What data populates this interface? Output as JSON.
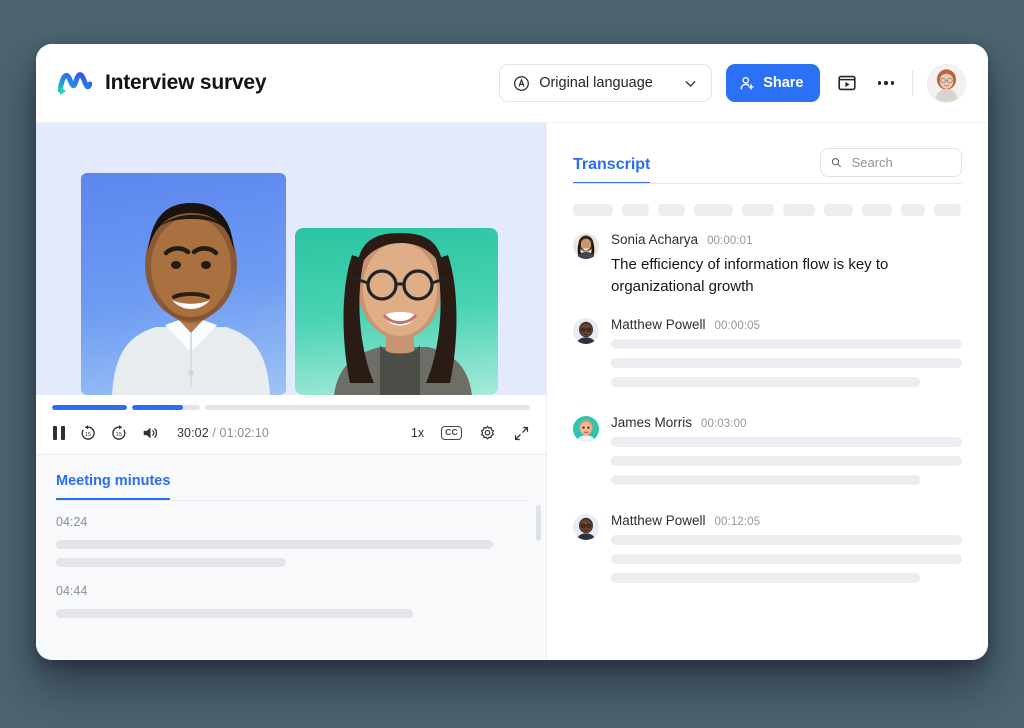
{
  "header": {
    "logo_icon": "wavy-logo-icon",
    "title": "Interview survey",
    "language": {
      "icon": "language-globe-icon",
      "value": "Original language",
      "chevron_icon": "chevron-down-icon"
    },
    "share": {
      "icon": "person-add-icon",
      "label": "Share"
    },
    "present_icon": "present-screen-icon",
    "more_icon": "more-horizontal-icon",
    "avatar": "user-avatar"
  },
  "video": {
    "background_color": "#e3eafc",
    "tiles": [
      {
        "name": "participant-tile-left",
        "accent": "#5b86f0"
      },
      {
        "name": "participant-tile-right",
        "accent": "#2bc4a0"
      }
    ]
  },
  "player": {
    "segments": [
      {
        "fill_percent": 100
      },
      {
        "fill_percent": 75
      },
      {
        "fill_percent": 0
      }
    ],
    "pause_icon": "pause-icon",
    "rewind_icon": "rewind-15-icon",
    "forward_icon": "forward-15-icon",
    "volume_icon": "volume-icon",
    "current_time": "30:02",
    "separator": "/",
    "total_time": "01:02:10",
    "speed_label": "1x",
    "captions_label": "CC",
    "settings_icon": "gear-icon",
    "fullscreen_icon": "expand-icon",
    "accent_color": "#2b6cf5"
  },
  "minutes": {
    "tab_label": "Meeting minutes",
    "entries": [
      {
        "time": "04:24",
        "lines": [
          93,
          49
        ]
      },
      {
        "time": "04:44",
        "lines": [
          76
        ]
      }
    ]
  },
  "transcript": {
    "tab_label": "Transcript",
    "search": {
      "icon": "search-icon",
      "placeholder": "Search",
      "value": ""
    },
    "chips": [
      40,
      27,
      27,
      39,
      32,
      32,
      29,
      30,
      24,
      27
    ],
    "entries": [
      {
        "name": "Sonia Acharya",
        "time": "00:00:01",
        "avatar": "sonia-avatar",
        "text": "The efficiency of information flow is key to organizational growth",
        "lines": []
      },
      {
        "name": "Matthew Powell",
        "time": "00:00:05",
        "avatar": "matthew-avatar",
        "text": "",
        "lines": [
          100,
          100,
          88
        ]
      },
      {
        "name": "James Morris",
        "time": "00:03:00",
        "avatar": "james-avatar",
        "text": "",
        "lines": [
          100,
          100,
          88
        ]
      },
      {
        "name": "Matthew Powell",
        "time": "00:12:05",
        "avatar": "matthew-avatar-2",
        "text": "",
        "lines": [
          100,
          100,
          88
        ]
      }
    ]
  },
  "colors": {
    "page_background": "#4c6570",
    "brand_blue": "#2b6cf5",
    "share_blue": "#2b71f5",
    "placeholder_gray": "#e3e5e8"
  }
}
